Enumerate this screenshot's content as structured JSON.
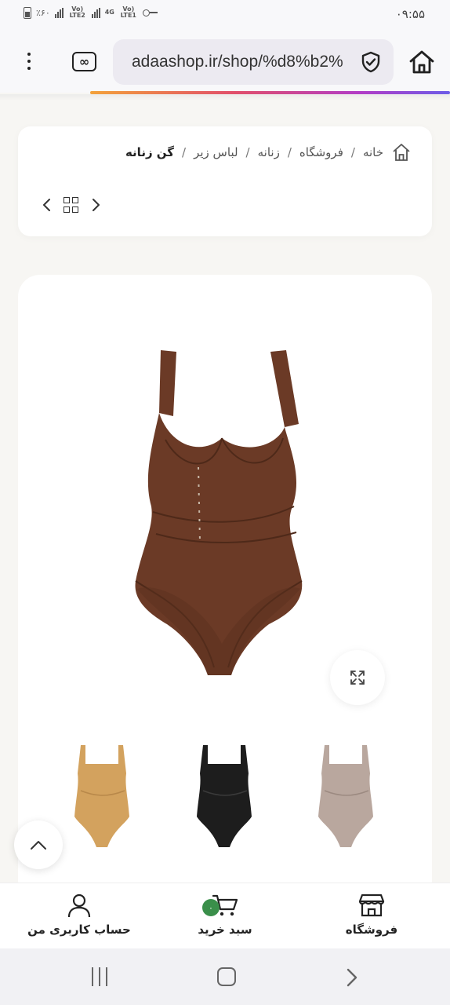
{
  "status_bar": {
    "time": "۰۹:۵۵",
    "battery": "٪۶۰",
    "sim1": "Vo) LTE2",
    "sim2_network": "4G",
    "sim2": "Vo) LTE1"
  },
  "browser": {
    "url": "adaashop.ir/shop/%d8%b2%",
    "icons": [
      "menu-dots-icon",
      "tabs-icon",
      "shield-check-icon",
      "home-icon"
    ]
  },
  "breadcrumb": {
    "items": [
      "خانه",
      "فروشگاه",
      "زنانه",
      "لباس زیر"
    ],
    "current": "گن زنانه",
    "separator": "/"
  },
  "product": {
    "main_image_color": "#6b3a26",
    "thumbnails": [
      {
        "name": "tan",
        "color": "#d3a25e"
      },
      {
        "name": "black",
        "color": "#1d1d1d"
      },
      {
        "name": "gray",
        "color": "#b9a79e"
      }
    ]
  },
  "bottom_nav": {
    "shop_label": "فروشگاه",
    "cart_label": "سبد خرید",
    "cart_count": "۰",
    "account_label": "حساب کاربری من"
  },
  "colors": {
    "cart_badge": "#3a8f4a",
    "progress_gradient": [
      "#f3a23a",
      "#e14f6a",
      "#b23cc6",
      "#6c5ce7"
    ]
  }
}
